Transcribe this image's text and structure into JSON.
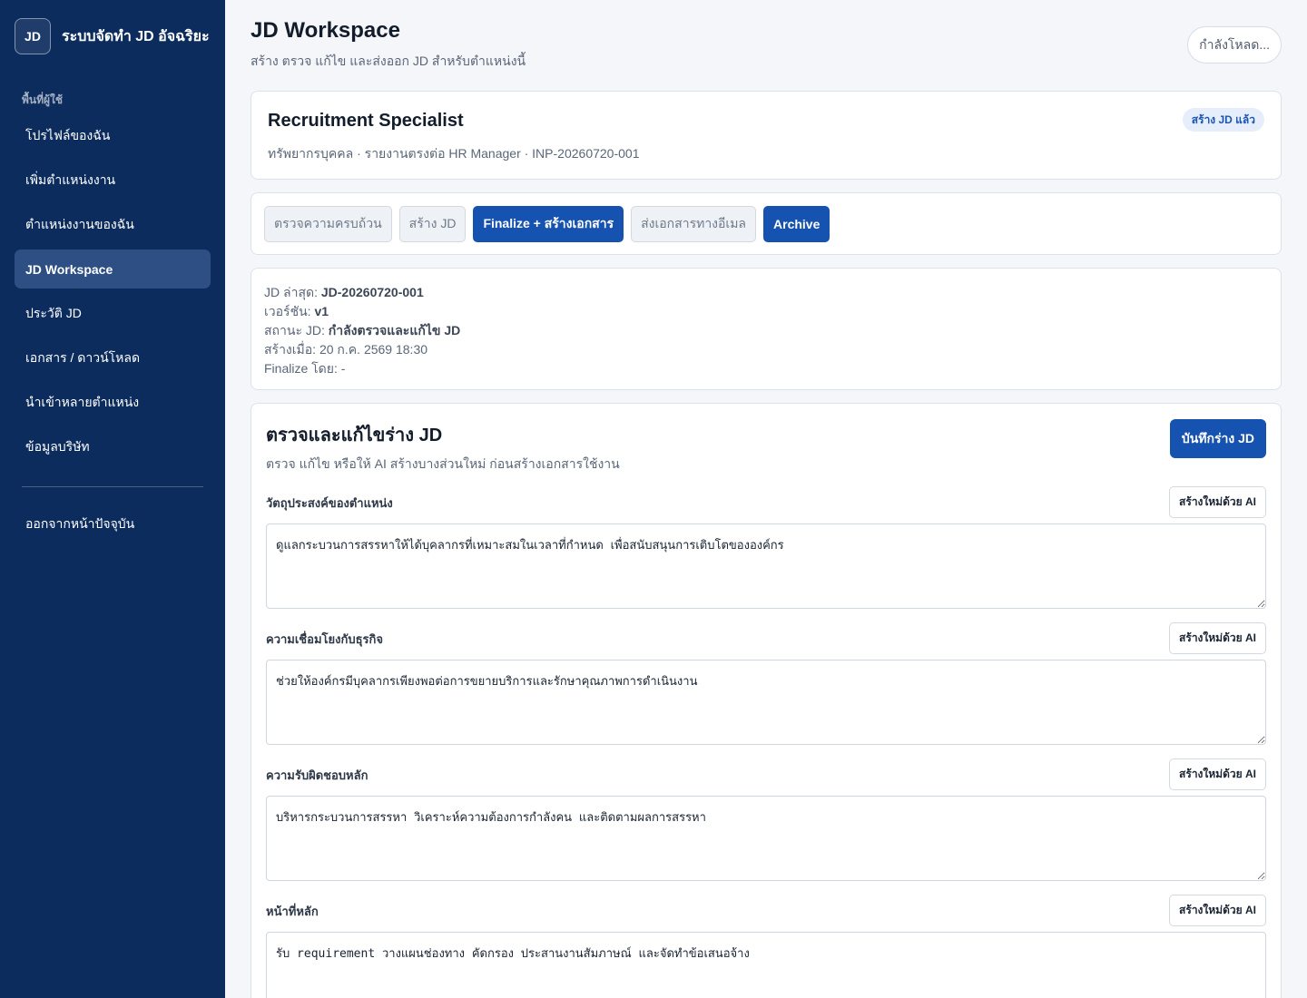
{
  "sidebar": {
    "logo": "JD",
    "app_name": "ระบบจัดทำ JD อัจฉริยะ",
    "section_label": "พื้นที่ผู้ใช้",
    "items": [
      {
        "label": "โปรไฟล์ของฉัน"
      },
      {
        "label": "เพิ่มตำแหน่งงาน"
      },
      {
        "label": "ตำแหน่งงานของฉัน"
      },
      {
        "label": "JD Workspace",
        "active": true
      },
      {
        "label": "ประวัติ JD"
      },
      {
        "label": "เอกสาร / ดาวน์โหลด"
      },
      {
        "label": "นำเข้าหลายตำแหน่ง"
      },
      {
        "label": "ข้อมูลบริษัท"
      }
    ],
    "logout_label": "ออกจากหน้าปัจจุบัน"
  },
  "header": {
    "title": "JD Workspace",
    "subtitle": "สร้าง ตรวจ แก้ไข และส่งออก JD สำหรับตำแหน่งนี้",
    "loading_label": "กำลังโหลด..."
  },
  "position": {
    "title": "Recruitment Specialist",
    "meta": "ทรัพยากรบุคคล · รายงานตรงต่อ HR Manager · INP-20260720-001",
    "status": "สร้าง JD แล้ว"
  },
  "actions": {
    "check": "ตรวจความครบถ้วน",
    "create": "สร้าง JD",
    "finalize": "Finalize + สร้างเอกสาร",
    "email": "ส่งเอกสารทางอีเมล",
    "archive": "Archive"
  },
  "jd_info": {
    "latest_label": "JD ล่าสุด:",
    "latest_value": "JD-20260720-001",
    "version_label": "เวอร์ชัน:",
    "version_value": "v1",
    "status_label": "สถานะ JD:",
    "status_value": "กำลังตรวจและแก้ไข JD",
    "created_label": "สร้างเมื่อ:",
    "created_value": "20 ก.ค. 2569 18:30",
    "finalized_label": "Finalize โดย:",
    "finalized_value": "-"
  },
  "editor": {
    "title": "ตรวจและแก้ไขร่าง JD",
    "subtitle": "ตรวจ แก้ไข หรือให้ AI สร้างบางส่วนใหม่ ก่อนสร้างเอกสารใช้งาน",
    "save_label": "บันทึกร่าง JD",
    "regen_label": "สร้างใหม่ด้วย AI",
    "fields": [
      {
        "label": "วัตถุประสงค์ของตำแหน่ง",
        "value": "ดูแลกระบวนการสรรหาให้ได้บุคลากรที่เหมาะสมในเวลาที่กำหนด เพื่อสนับสนุนการเติบโตขององค์กร"
      },
      {
        "label": "ความเชื่อมโยงกับธุรกิจ",
        "value": "ช่วยให้องค์กรมีบุคลากรเพียงพอต่อการขยายบริการและรักษาคุณภาพการดำเนินงาน"
      },
      {
        "label": "ความรับผิดชอบหลัก",
        "value": "บริหารกระบวนการสรรหา วิเคราะห์ความต้องการกำลังคน และติดตามผลการสรรหา"
      },
      {
        "label": "หน้าที่หลัก",
        "value": "รับ requirement วางแผนช่องทาง คัดกรอง ประสานงานสัมภาษณ์ และจัดทำข้อเสนอจ้าง"
      }
    ]
  }
}
